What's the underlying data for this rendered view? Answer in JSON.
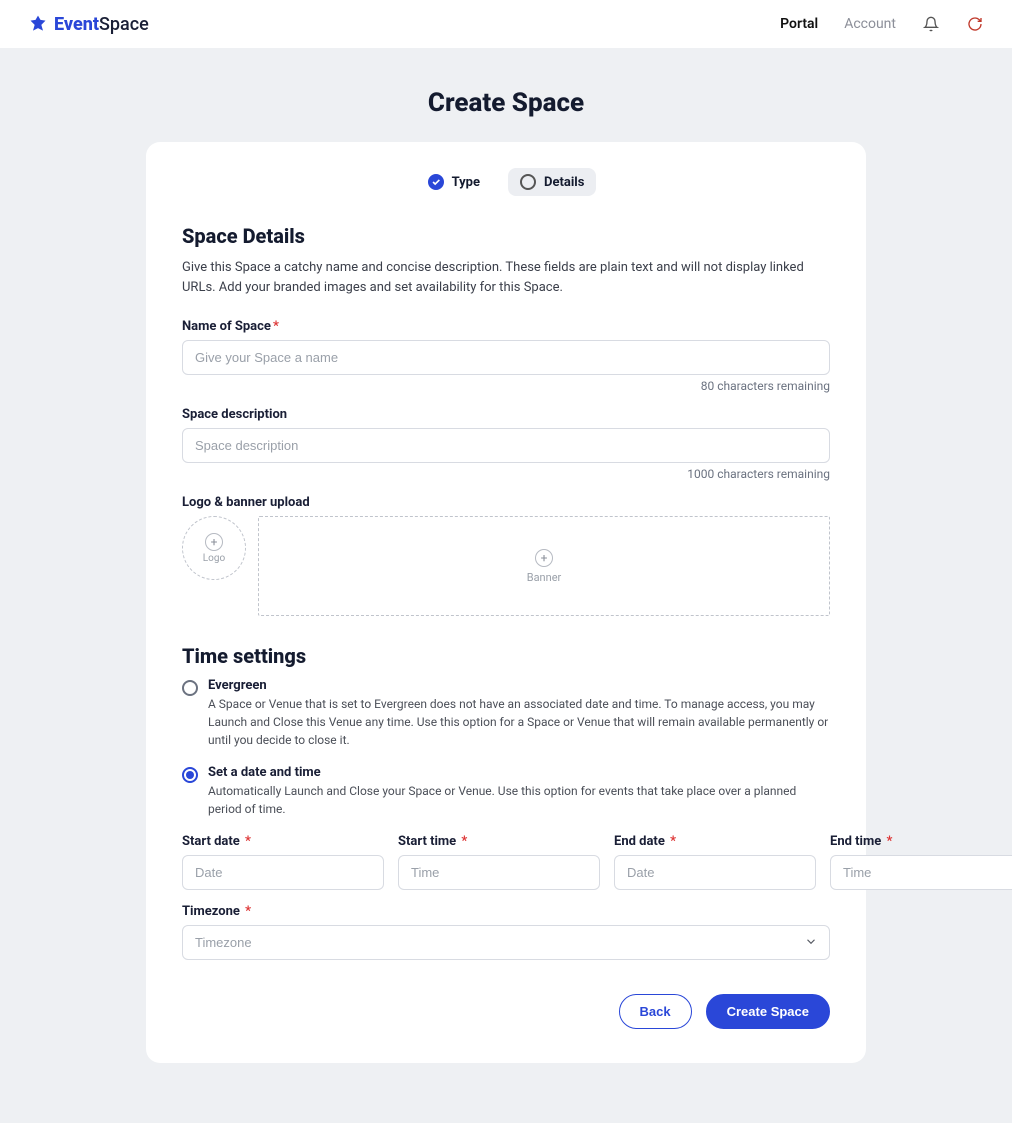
{
  "brand": {
    "strong": "Event",
    "rest": "Space"
  },
  "nav": {
    "portal": "Portal",
    "account": "Account"
  },
  "page_title": "Create Space",
  "stepper": {
    "type_label": "Type",
    "details_label": "Details"
  },
  "space_details": {
    "heading": "Space Details",
    "desc": "Give this Space a catchy name and concise description. These fields are plain text and will not display linked URLs. Add your branded images and set availability for this Space.",
    "name_label": "Name of Space",
    "name_placeholder": "Give your Space a name",
    "name_helper": "80 characters remaining",
    "desc_label": "Space description",
    "desc_placeholder": "Space description",
    "desc_helper": "1000 characters remaining",
    "upload_label": "Logo & banner upload",
    "logo_caption": "Logo",
    "banner_caption": "Banner"
  },
  "time_settings": {
    "heading": "Time settings",
    "evergreen_title": "Evergreen",
    "evergreen_desc": "A Space or Venue that is set to Evergreen does not have an associated date and time. To manage access, you may Launch and Close this Venue any time. Use this option for a Space or Venue that will remain available permanently or until you decide to close it.",
    "scheduled_title": "Set a date and time",
    "scheduled_desc": "Automatically Launch and Close your Space or Venue. Use this option for events that take place over a planned period of time.",
    "start_date_label": "Start date",
    "start_time_label": "Start time",
    "end_date_label": "End date",
    "end_time_label": "End time",
    "date_placeholder": "Date",
    "time_placeholder": "Time",
    "timezone_label": "Timezone",
    "timezone_placeholder": "Timezone"
  },
  "actions": {
    "back": "Back",
    "create": "Create Space"
  }
}
